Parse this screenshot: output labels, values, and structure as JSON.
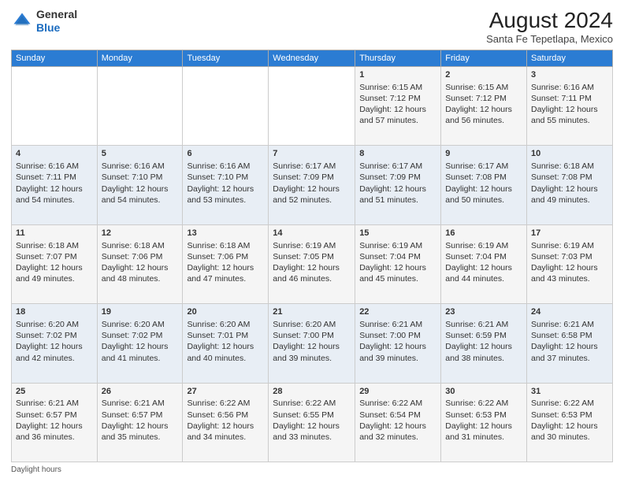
{
  "logo": {
    "general": "General",
    "blue": "Blue"
  },
  "title": {
    "month_year": "August 2024",
    "location": "Santa Fe Tepetlapa, Mexico"
  },
  "days_of_week": [
    "Sunday",
    "Monday",
    "Tuesday",
    "Wednesday",
    "Thursday",
    "Friday",
    "Saturday"
  ],
  "weeks": [
    [
      {
        "day": "",
        "info": ""
      },
      {
        "day": "",
        "info": ""
      },
      {
        "day": "",
        "info": ""
      },
      {
        "day": "",
        "info": ""
      },
      {
        "day": "1",
        "info": "Sunrise: 6:15 AM\nSunset: 7:12 PM\nDaylight: 12 hours and 57 minutes."
      },
      {
        "day": "2",
        "info": "Sunrise: 6:15 AM\nSunset: 7:12 PM\nDaylight: 12 hours and 56 minutes."
      },
      {
        "day": "3",
        "info": "Sunrise: 6:16 AM\nSunset: 7:11 PM\nDaylight: 12 hours and 55 minutes."
      }
    ],
    [
      {
        "day": "4",
        "info": "Sunrise: 6:16 AM\nSunset: 7:11 PM\nDaylight: 12 hours and 54 minutes."
      },
      {
        "day": "5",
        "info": "Sunrise: 6:16 AM\nSunset: 7:10 PM\nDaylight: 12 hours and 54 minutes."
      },
      {
        "day": "6",
        "info": "Sunrise: 6:16 AM\nSunset: 7:10 PM\nDaylight: 12 hours and 53 minutes."
      },
      {
        "day": "7",
        "info": "Sunrise: 6:17 AM\nSunset: 7:09 PM\nDaylight: 12 hours and 52 minutes."
      },
      {
        "day": "8",
        "info": "Sunrise: 6:17 AM\nSunset: 7:09 PM\nDaylight: 12 hours and 51 minutes."
      },
      {
        "day": "9",
        "info": "Sunrise: 6:17 AM\nSunset: 7:08 PM\nDaylight: 12 hours and 50 minutes."
      },
      {
        "day": "10",
        "info": "Sunrise: 6:18 AM\nSunset: 7:08 PM\nDaylight: 12 hours and 49 minutes."
      }
    ],
    [
      {
        "day": "11",
        "info": "Sunrise: 6:18 AM\nSunset: 7:07 PM\nDaylight: 12 hours and 49 minutes."
      },
      {
        "day": "12",
        "info": "Sunrise: 6:18 AM\nSunset: 7:06 PM\nDaylight: 12 hours and 48 minutes."
      },
      {
        "day": "13",
        "info": "Sunrise: 6:18 AM\nSunset: 7:06 PM\nDaylight: 12 hours and 47 minutes."
      },
      {
        "day": "14",
        "info": "Sunrise: 6:19 AM\nSunset: 7:05 PM\nDaylight: 12 hours and 46 minutes."
      },
      {
        "day": "15",
        "info": "Sunrise: 6:19 AM\nSunset: 7:04 PM\nDaylight: 12 hours and 45 minutes."
      },
      {
        "day": "16",
        "info": "Sunrise: 6:19 AM\nSunset: 7:04 PM\nDaylight: 12 hours and 44 minutes."
      },
      {
        "day": "17",
        "info": "Sunrise: 6:19 AM\nSunset: 7:03 PM\nDaylight: 12 hours and 43 minutes."
      }
    ],
    [
      {
        "day": "18",
        "info": "Sunrise: 6:20 AM\nSunset: 7:02 PM\nDaylight: 12 hours and 42 minutes."
      },
      {
        "day": "19",
        "info": "Sunrise: 6:20 AM\nSunset: 7:02 PM\nDaylight: 12 hours and 41 minutes."
      },
      {
        "day": "20",
        "info": "Sunrise: 6:20 AM\nSunset: 7:01 PM\nDaylight: 12 hours and 40 minutes."
      },
      {
        "day": "21",
        "info": "Sunrise: 6:20 AM\nSunset: 7:00 PM\nDaylight: 12 hours and 39 minutes."
      },
      {
        "day": "22",
        "info": "Sunrise: 6:21 AM\nSunset: 7:00 PM\nDaylight: 12 hours and 39 minutes."
      },
      {
        "day": "23",
        "info": "Sunrise: 6:21 AM\nSunset: 6:59 PM\nDaylight: 12 hours and 38 minutes."
      },
      {
        "day": "24",
        "info": "Sunrise: 6:21 AM\nSunset: 6:58 PM\nDaylight: 12 hours and 37 minutes."
      }
    ],
    [
      {
        "day": "25",
        "info": "Sunrise: 6:21 AM\nSunset: 6:57 PM\nDaylight: 12 hours and 36 minutes."
      },
      {
        "day": "26",
        "info": "Sunrise: 6:21 AM\nSunset: 6:57 PM\nDaylight: 12 hours and 35 minutes."
      },
      {
        "day": "27",
        "info": "Sunrise: 6:22 AM\nSunset: 6:56 PM\nDaylight: 12 hours and 34 minutes."
      },
      {
        "day": "28",
        "info": "Sunrise: 6:22 AM\nSunset: 6:55 PM\nDaylight: 12 hours and 33 minutes."
      },
      {
        "day": "29",
        "info": "Sunrise: 6:22 AM\nSunset: 6:54 PM\nDaylight: 12 hours and 32 minutes."
      },
      {
        "day": "30",
        "info": "Sunrise: 6:22 AM\nSunset: 6:53 PM\nDaylight: 12 hours and 31 minutes."
      },
      {
        "day": "31",
        "info": "Sunrise: 6:22 AM\nSunset: 6:53 PM\nDaylight: 12 hours and 30 minutes."
      }
    ]
  ],
  "footer": "Daylight hours"
}
